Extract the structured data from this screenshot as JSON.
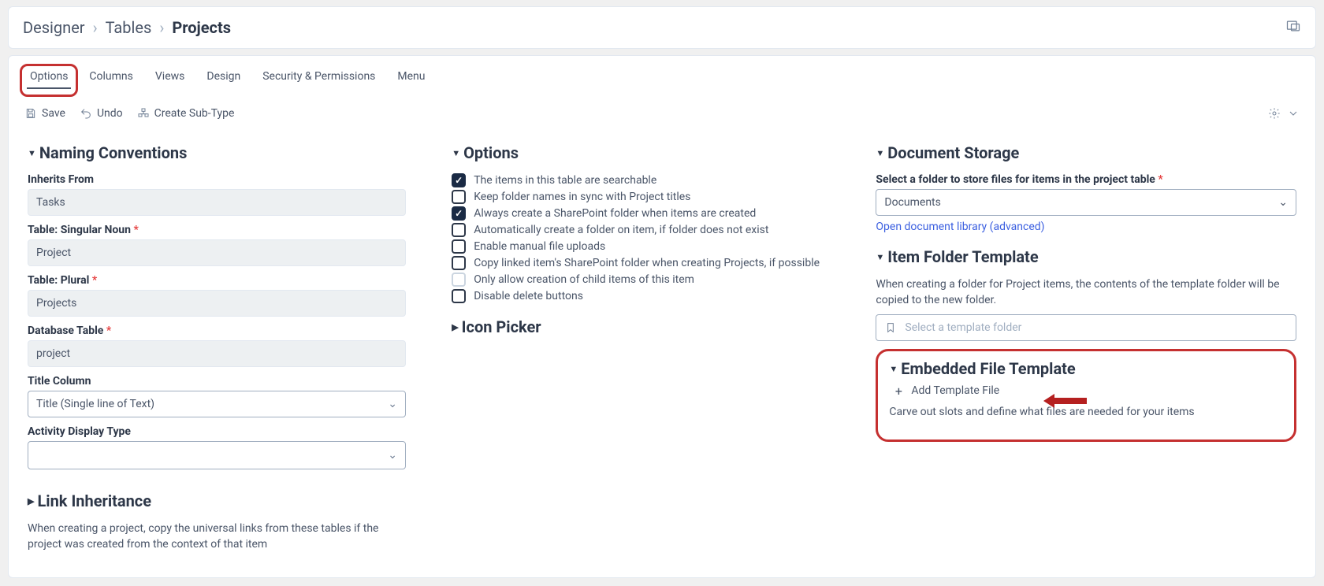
{
  "breadcrumb": {
    "root": "Designer",
    "mid": "Tables",
    "current": "Projects"
  },
  "tabs": {
    "options": "Options",
    "columns": "Columns",
    "views": "Views",
    "design": "Design",
    "security": "Security & Permissions",
    "menu": "Menu"
  },
  "toolbar": {
    "save": "Save",
    "undo": "Undo",
    "create_sub": "Create Sub-Type"
  },
  "naming": {
    "title": "Naming Conventions",
    "inherits_label": "Inherits From",
    "inherits_value": "Tasks",
    "singular_label": "Table: Singular Noun",
    "singular_value": "Project",
    "plural_label": "Table: Plural",
    "plural_value": "Projects",
    "db_label": "Database Table",
    "db_value": "project",
    "title_col_label": "Title Column",
    "title_col_value": "Title (Single line of Text)",
    "activity_label": "Activity Display Type"
  },
  "link_inherit": {
    "title": "Link Inheritance",
    "desc": "When creating a project, copy the universal links from these tables if the project was created from the context of that item"
  },
  "options": {
    "title": "Options",
    "o1": "The items in this table are searchable",
    "o2": "Keep folder names in sync with Project titles",
    "o3": "Always create a SharePoint folder when items are created",
    "o4": "Automatically create a folder on item, if folder does not exist",
    "o5": "Enable manual file uploads",
    "o6": "Copy linked item's SharePoint folder when creating Projects, if possible",
    "o7": "Only allow creation of child items of this item",
    "o8": "Disable delete buttons"
  },
  "icon_picker": {
    "title": "Icon Picker"
  },
  "doc_storage": {
    "title": "Document Storage",
    "select_label": "Select a folder to store files for items in the project table",
    "select_value": "Documents",
    "open_link": "Open document library (advanced)"
  },
  "item_folder": {
    "title": "Item Folder Template",
    "desc": "When creating a folder for Project items, the contents of the template folder will be copied to the new folder.",
    "placeholder": "Select a template folder"
  },
  "embedded": {
    "title": "Embedded File Template",
    "add": "Add Template File",
    "desc": "Carve out slots and define what files are needed for your items"
  }
}
